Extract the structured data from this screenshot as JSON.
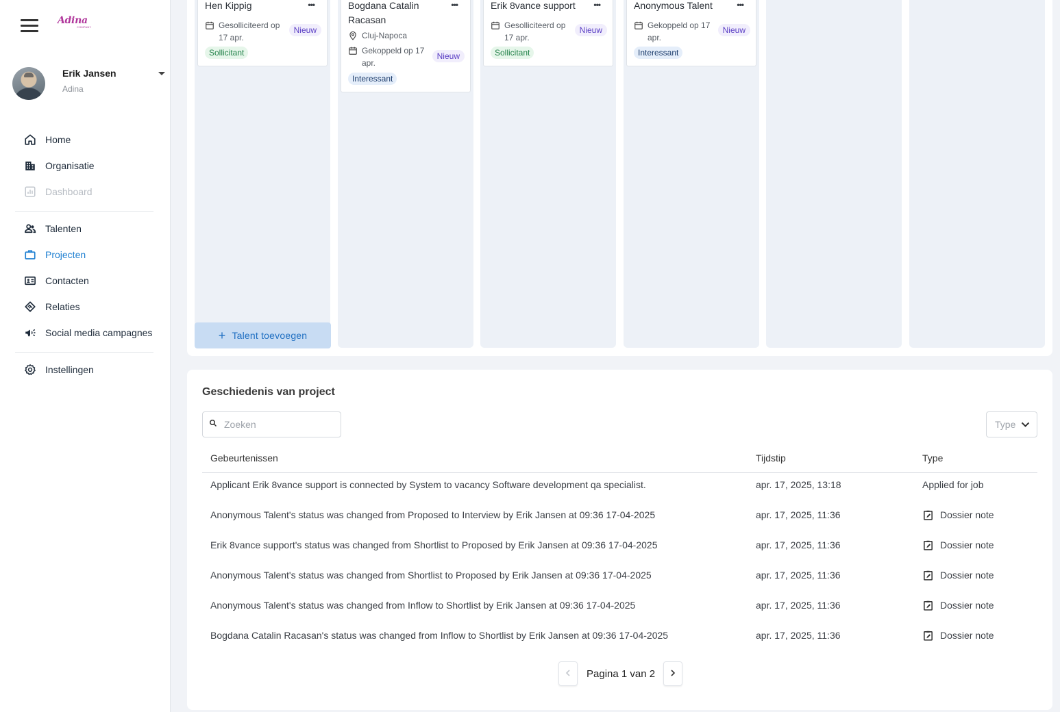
{
  "app": {
    "logo_text": "Adina",
    "logo_subtext": "COMPANY"
  },
  "user": {
    "name": "Erik Jansen",
    "org": "Adina"
  },
  "nav": {
    "home": "Home",
    "organisatie": "Organisatie",
    "dashboard": "Dashboard",
    "talenten": "Talenten",
    "projecten": "Projecten",
    "contacten": "Contacten",
    "relaties": "Relaties",
    "social": "Social media campagnes",
    "instellingen": "Instellingen",
    "active_item": "Projecten",
    "disabled_item": "Dashboard"
  },
  "board": {
    "add_talent_label": "Talent toevoegen",
    "cards": [
      {
        "name": "Hen Kippig",
        "date_text": "Gesolliciteerd op 17 apr.",
        "badge": "Nieuw",
        "status": "Sollicitant"
      },
      {
        "name": "Bogdana Catalin Racasan",
        "location": "Cluj-Napoca",
        "date_text": "Gekoppeld op 17 apr.",
        "badge": "Nieuw",
        "status": "Interessant"
      },
      {
        "name": "Erik 8vance support",
        "date_text": "Gesolliciteerd op 17 apr.",
        "badge": "Nieuw",
        "status": "Sollicitant"
      },
      {
        "name": "Anonymous Talent",
        "date_text": "Gekoppeld op 17 apr.",
        "badge": "Nieuw",
        "status": "Interessant"
      }
    ]
  },
  "history": {
    "title": "Geschiedenis van project",
    "search_placeholder": "Zoeken",
    "type_filter_label": "Type",
    "columns": [
      "Gebeurtenissen",
      "Tijdstip",
      "Type"
    ],
    "rows": [
      {
        "event": "Applicant Erik 8vance support is connected by System to vacancy Software development qa specialist.",
        "time": "apr. 17, 2025, 13:18",
        "type": "Applied for job",
        "icon": ""
      },
      {
        "event": "Anonymous Talent's status was changed from Proposed to Interview by Erik Jansen at 09:36 17-04-2025",
        "time": "apr. 17, 2025, 11:36",
        "type": "Dossier note",
        "icon": "note-edit-icon"
      },
      {
        "event": "Erik 8vance support's status was changed from Shortlist to Proposed by Erik Jansen at 09:36 17-04-2025",
        "time": "apr. 17, 2025, 11:36",
        "type": "Dossier note",
        "icon": "note-edit-icon"
      },
      {
        "event": "Anonymous Talent's status was changed from Shortlist to Proposed by Erik Jansen at 09:36 17-04-2025",
        "time": "apr. 17, 2025, 11:36",
        "type": "Dossier note",
        "icon": "note-edit-icon"
      },
      {
        "event": "Anonymous Talent's status was changed from Inflow to Shortlist by Erik Jansen at 09:36 17-04-2025",
        "time": "apr. 17, 2025, 11:36",
        "type": "Dossier note",
        "icon": "note-edit-icon"
      },
      {
        "event": "Bogdana Catalin Racasan's status was changed from Inflow to Shortlist by Erik Jansen at 09:36 17-04-2025",
        "time": "apr. 17, 2025, 11:36",
        "type": "Dossier note",
        "icon": "note-edit-icon"
      }
    ],
    "pagination_label": "Pagina 1 van 2",
    "current_page": 1,
    "total_pages": 2
  },
  "colors": {
    "accent": "#1e7fd1",
    "badge_new": "#5b3fc4",
    "status_green": "#23824a",
    "status_blue": "#1b3b6b",
    "column_bg": "#edf1f7",
    "logo": "#b0369b"
  }
}
